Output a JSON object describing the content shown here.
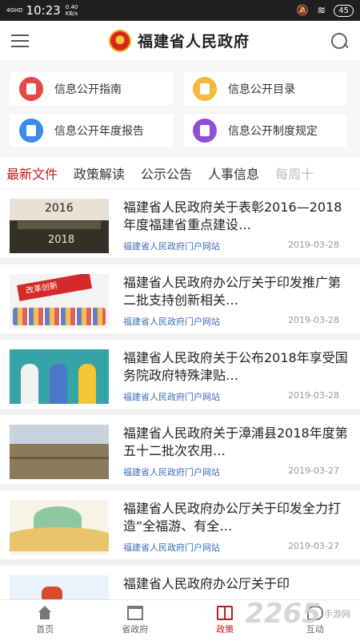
{
  "status_bar": {
    "network": "4GHD",
    "time": "10:23",
    "speed_value": "0.40",
    "speed_unit": "KB/s",
    "battery": "45"
  },
  "header": {
    "title": "福建省人民政府"
  },
  "quick_links": [
    {
      "label": "信息公开指南",
      "color": "#e84848"
    },
    {
      "label": "信息公开目录",
      "color": "#f4b93c"
    },
    {
      "label": "信息公开年度报告",
      "color": "#3f8be8"
    },
    {
      "label": "信息公开制度规定",
      "color": "#8d4fd6"
    }
  ],
  "tabs": [
    "最新文件",
    "政策解读",
    "公示公告",
    "人事信息",
    "每周十"
  ],
  "news": [
    {
      "title": "福建省人民政府关于表彰2016—2018年度福建省重点建设…",
      "source": "福建省人民政府门户网站",
      "date": "2019-03-28"
    },
    {
      "title": "福建省人民政府办公厅关于印发推广第二批支持创新相关…",
      "source": "福建省人民政府门户网站",
      "date": "2019-03-28"
    },
    {
      "title": "福建省人民政府关于公布2018年享受国务院政府特殊津贴…",
      "source": "福建省人民政府门户网站",
      "date": "2019-03-28"
    },
    {
      "title": "福建省人民政府关于漳浦县2018年度第五十二批次农用…",
      "source": "福建省人民政府门户网站",
      "date": "2019-03-27"
    },
    {
      "title": "福建省人民政府办公厅关于印发全力打造“全福游、有全…",
      "source": "福建省人民政府门户网站",
      "date": "2019-03-27"
    },
    {
      "title": "福建省人民政府办公厅关于印",
      "source": "",
      "date": ""
    }
  ],
  "thumbs": {
    "t1_top": "2016",
    "t1_bottom": "2018",
    "t2_banner": "改革创新"
  },
  "bottom_nav": [
    {
      "label": "首页",
      "icon": "home-icon"
    },
    {
      "label": "省政府",
      "icon": "building-icon"
    },
    {
      "label": "政策",
      "icon": "policy-icon"
    },
    {
      "label": "互动",
      "icon": "chat-icon"
    }
  ],
  "watermark": {
    "number": "2265",
    "text": "手游网"
  }
}
